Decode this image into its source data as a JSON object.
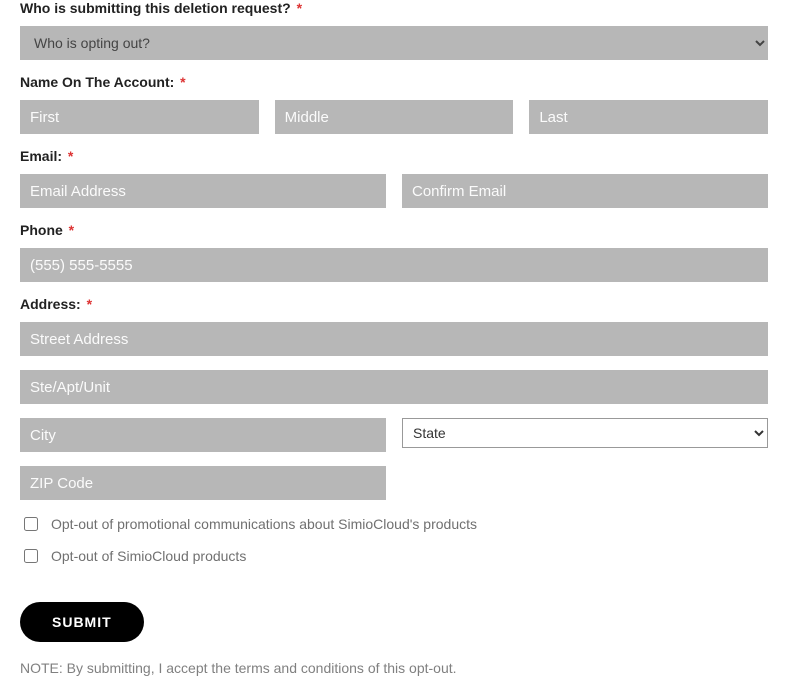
{
  "labels": {
    "who": "Who is submitting this deletion request?",
    "name": "Name On The Account:",
    "email": "Email:",
    "phone": "Phone",
    "address": "Address:"
  },
  "placeholders": {
    "who_option": "Who is opting out?",
    "first": "First",
    "middle": "Middle",
    "last": "Last",
    "email": "Email Address",
    "confirm_email": "Confirm Email",
    "phone": "(555) 555-5555",
    "street": "Street Address",
    "unit": "Ste/Apt/Unit",
    "city": "City",
    "state": "State",
    "zip": "ZIP Code"
  },
  "checkboxes": {
    "promo": "Opt-out of promotional communications about SimioCloud's products",
    "products": "Opt-out of SimioCloud products"
  },
  "submit": "SUBMIT",
  "note": "NOTE: By submitting, I accept the terms and conditions of this opt-out."
}
